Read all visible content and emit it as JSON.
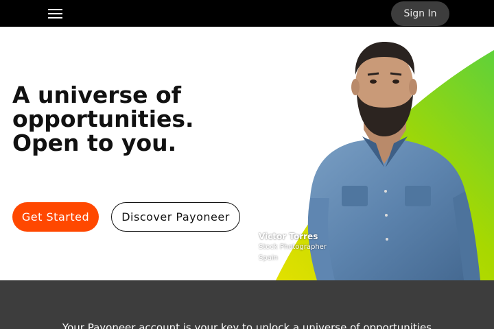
{
  "nav": {
    "menu_icon": "hamburger-menu-icon",
    "signin_label": "Sign In"
  },
  "hero": {
    "headline_lines": [
      "A universe of",
      "opportunities.",
      "Open to you."
    ],
    "get_started_label": "Get Started",
    "discover_label": "Discover Payoneer",
    "caption": {
      "name": "Victor Torres",
      "role": "Stock Photographer",
      "location": "Spain"
    }
  },
  "band": {
    "text": "Your Payoneer account is your key to unlock a universe of opportunities"
  },
  "colors": {
    "topbar": "#000000",
    "signin_bg": "#3d3d3d",
    "accent_orange": "#ff4800",
    "band_bg": "#3d3d3d",
    "gradient_yellow": "#e2e000",
    "gradient_green": "#5fd13a"
  }
}
